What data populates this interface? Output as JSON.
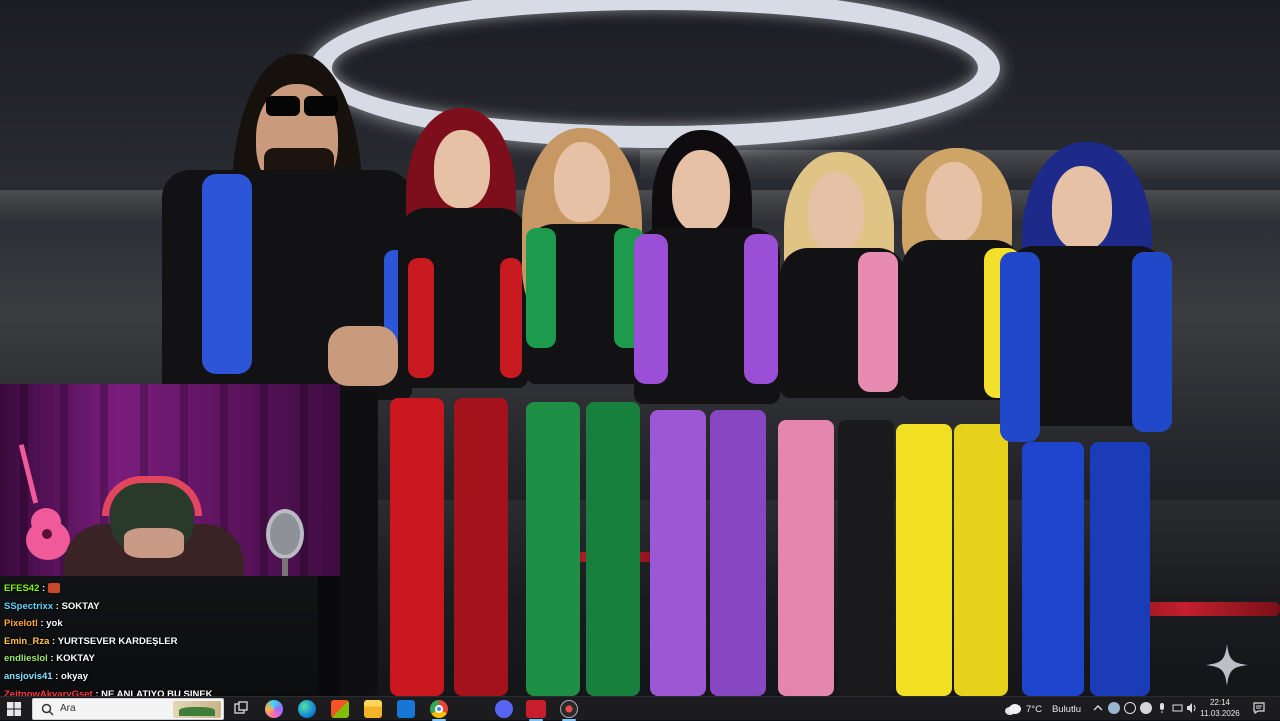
{
  "chat": {
    "messages": [
      {
        "user": "EFES42",
        "text": "",
        "color": "#7CFC00"
      },
      {
        "user": "SSpectrixx",
        "text": "SOKTAY",
        "color": "#5FD3FF"
      },
      {
        "user": "Pixelotl",
        "text": "yok",
        "color": "#FFA833"
      },
      {
        "user": "Emin_Rza",
        "text": "YURTSEVER KARDEŞLER",
        "color": "#FFC44D"
      },
      {
        "user": "endlieslol",
        "text": "KOKTAY",
        "color": "#9BE86F"
      },
      {
        "user": "ansjovis41",
        "text": "okyay",
        "color": "#7FE3FF"
      },
      {
        "user": "ZeitnowAkvaryGset",
        "text": "NE ANLATIYO BU SINEK",
        "color": "#FF3B3B"
      }
    ]
  },
  "taskbar": {
    "search_placeholder": "Ara",
    "weather": {
      "temp": "7°C",
      "condition": "Bulutlu"
    },
    "clock": {
      "time": "22:14",
      "date": "11.03.2026"
    }
  },
  "colors": {
    "taskbar_bg": "#1c1c1f",
    "halo": "#d7dbe6",
    "webcam_purple": "#7a1d7e"
  }
}
